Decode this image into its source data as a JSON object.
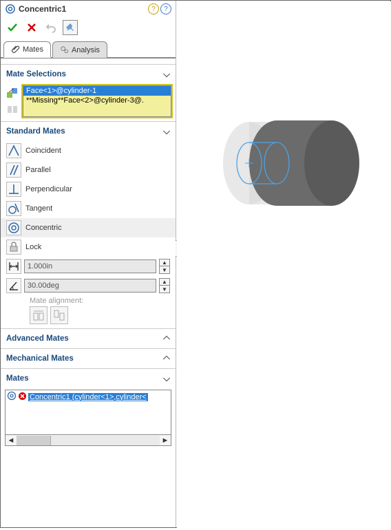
{
  "header": {
    "title": "Concentric1"
  },
  "tabs": {
    "mates": "Mates",
    "analysis": "Analysis"
  },
  "sections": {
    "mate_selections": "Mate Selections",
    "standard_mates": "Standard Mates",
    "advanced_mates": "Advanced Mates",
    "mechanical_mates": "Mechanical Mates",
    "mates": "Mates"
  },
  "selections": {
    "item1": "Face<1>@cylinder-1",
    "item2": "**Missing**Face<2>@cylinder-3@."
  },
  "standard": {
    "coincident": "Coincident",
    "parallel": "Parallel",
    "perpendicular": "Perpendicular",
    "tangent": "Tangent",
    "concentric": "Concentric",
    "lock": "Lock",
    "distance_value": "1.000in",
    "angle_value": "30.00deg",
    "alignment_label": "Mate alignment:"
  },
  "mates_list": {
    "item1": "Concentric1 (cylinder<1>,cylinder<"
  }
}
